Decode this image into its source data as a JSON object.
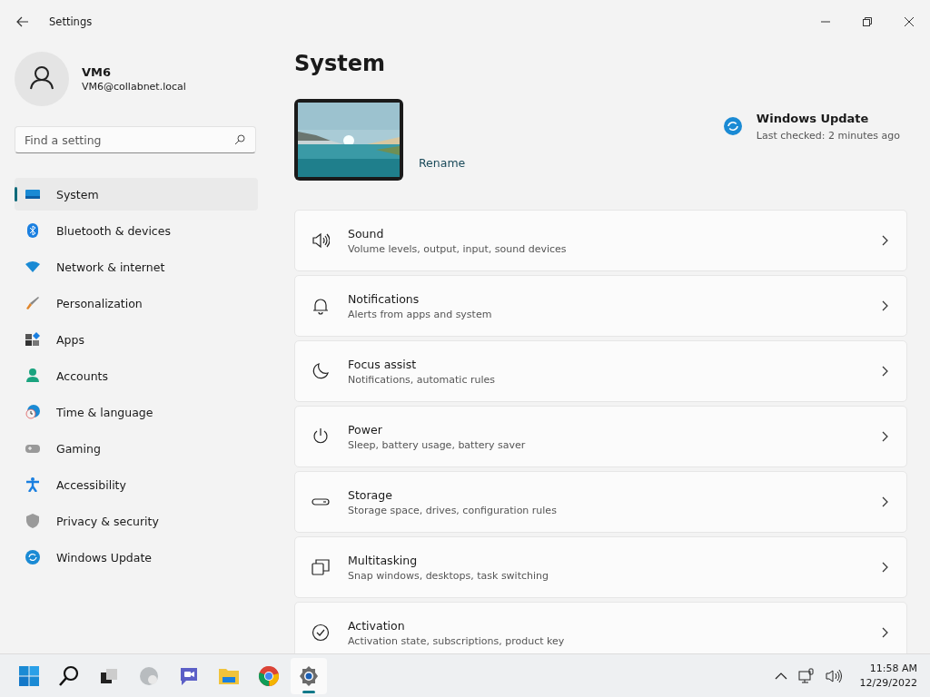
{
  "window": {
    "title": "Settings"
  },
  "account": {
    "name": "VM6",
    "email": "VM6@collabnet.local"
  },
  "search": {
    "placeholder": "Find a setting"
  },
  "nav": [
    {
      "label": "System",
      "selected": true
    },
    {
      "label": "Bluetooth & devices",
      "selected": false
    },
    {
      "label": "Network & internet",
      "selected": false
    },
    {
      "label": "Personalization",
      "selected": false
    },
    {
      "label": "Apps",
      "selected": false
    },
    {
      "label": "Accounts",
      "selected": false
    },
    {
      "label": "Time & language",
      "selected": false
    },
    {
      "label": "Gaming",
      "selected": false
    },
    {
      "label": "Accessibility",
      "selected": false
    },
    {
      "label": "Privacy & security",
      "selected": false
    },
    {
      "label": "Windows Update",
      "selected": false
    }
  ],
  "page": {
    "title": "System",
    "rename": "Rename",
    "update": {
      "title": "Windows Update",
      "status": "Last checked: 2 minutes ago"
    }
  },
  "settings": [
    {
      "title": "Sound",
      "description": "Volume levels, output, input, sound devices"
    },
    {
      "title": "Notifications",
      "description": "Alerts from apps and system"
    },
    {
      "title": "Focus assist",
      "description": "Notifications, automatic rules"
    },
    {
      "title": "Power",
      "description": "Sleep, battery usage, battery saver"
    },
    {
      "title": "Storage",
      "description": "Storage space, drives, configuration rules"
    },
    {
      "title": "Multitasking",
      "description": "Snap windows, desktops, task switching"
    },
    {
      "title": "Activation",
      "description": "Activation state, subscriptions, product key"
    }
  ],
  "taskbar": {
    "apps": [
      {
        "selected": false
      },
      {
        "selected": false
      },
      {
        "selected": false
      },
      {
        "selected": false
      },
      {
        "selected": false
      },
      {
        "selected": false
      },
      {
        "selected": false
      },
      {
        "selected": true
      }
    ],
    "time": "11:58 AM",
    "date": "12/29/2022"
  }
}
